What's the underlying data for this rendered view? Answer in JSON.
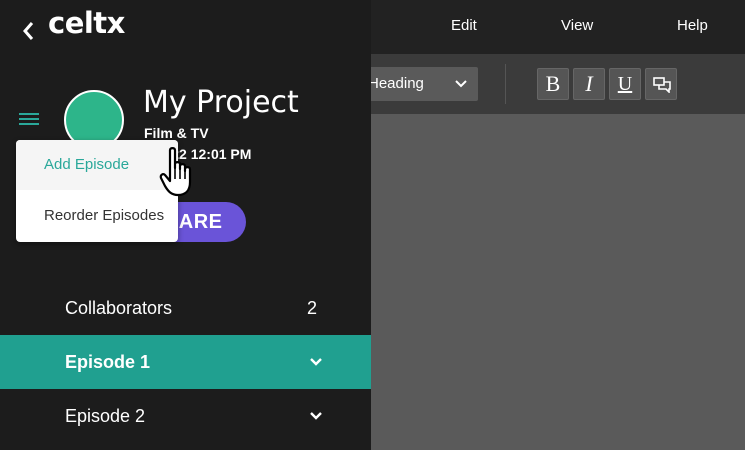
{
  "menu": {
    "edit": "Edit",
    "view": "View",
    "help": "Help"
  },
  "toolbar": {
    "style_value": "Heading",
    "bold_label": "B",
    "italic_label": "I",
    "underline_label": "U"
  },
  "sidebar": {
    "logo": "celtx",
    "project_title": "My Project",
    "project_type": "Film & TV",
    "project_date": "19 | 22 12:01 PM",
    "share_label": "SHARE",
    "rows": [
      {
        "label": "Collaborators",
        "count": "2"
      },
      {
        "label": "Episode 1"
      },
      {
        "label": "Episode 2"
      }
    ]
  },
  "popup": {
    "items": [
      {
        "label": "Add Episode"
      },
      {
        "label": "Reorder Episodes"
      }
    ]
  },
  "colors": {
    "accent_teal": "#20a090",
    "share_purple": "#6a54d8",
    "avatar_green": "#2db58a"
  }
}
